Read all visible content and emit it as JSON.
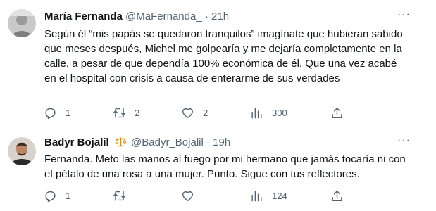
{
  "tweets": [
    {
      "name": "María Fernanda",
      "handle": "@MaFernanda_",
      "separator": "·",
      "time": "21h",
      "text": "Según él “mis papás se quedaron tranquilos” imagínate que hubieran sabido que meses después, Michel me golpearía y me dejaría completamente en la calle, a pesar de que dependía 100% económica de él.  Que una vez acabé en el hospital con crisis a causa de enterarme de sus verdades",
      "more": "···",
      "replies": "1",
      "retweets": "2",
      "likes": "2",
      "views": "300"
    },
    {
      "name": "Badyr Bojalil",
      "handle": "@Badyr_Bojalil",
      "separator": "·",
      "time": "19h",
      "text": "Fernanda. Meto las manos al fuego por mi hermano que jamás tocaría ni con el pétalo de una rosa a una mujer. Punto. Sigue con tus reflectores.",
      "more": "···",
      "replies": "1",
      "retweets": "",
      "likes": "",
      "views": "124"
    }
  ],
  "icons": {
    "reply": "reply-icon",
    "retweet": "retweet-icon",
    "like": "heart-icon",
    "views": "views-chart-icon",
    "share": "share-icon",
    "badge": "scales-emoji-icon"
  },
  "colors": {
    "text": "#0f1419",
    "secondary": "#536471",
    "divider": "#eff3f4",
    "background": "#ffffff"
  }
}
